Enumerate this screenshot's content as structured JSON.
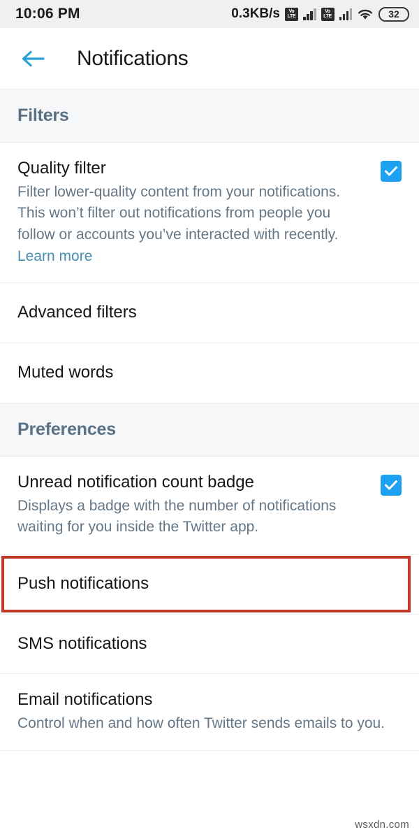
{
  "statusbar": {
    "time": "10:06 PM",
    "network_speed": "0.3KB/s",
    "volte_top": "Vo",
    "volte_bottom": "LTE",
    "battery_level": "32"
  },
  "appbar": {
    "title": "Notifications",
    "back_icon": "arrow-left-icon",
    "back_color": "#1d9bf0"
  },
  "sections": [
    {
      "header": "Filters",
      "rows": [
        {
          "title": "Quality filter",
          "desc_before_link": "Filter lower-quality content from your notifications. This won’t filter out notifications from people you follow or accounts you’ve interacted with recently. ",
          "link": "Learn more",
          "checkbox": "checked"
        },
        {
          "title": "Advanced filters"
        },
        {
          "title": "Muted words"
        }
      ]
    },
    {
      "header": "Preferences",
      "rows": [
        {
          "title": "Unread notification count badge",
          "desc": "Displays a badge with the number of notifications waiting for you inside the Twitter app.",
          "checkbox": "checked"
        },
        {
          "title": "Push notifications",
          "highlighted": true
        },
        {
          "title": "SMS notifications"
        },
        {
          "title": "Email notifications",
          "desc": "Control when and how often Twitter sends emails to you."
        }
      ]
    }
  ],
  "colors": {
    "accent_blue": "#1da1f2",
    "link_blue": "#4b8eb5",
    "section_gray": "#5b7083",
    "highlight_red": "#c0392b",
    "band_bg": "#f5f7f9"
  },
  "watermark": "wsxdn.com"
}
